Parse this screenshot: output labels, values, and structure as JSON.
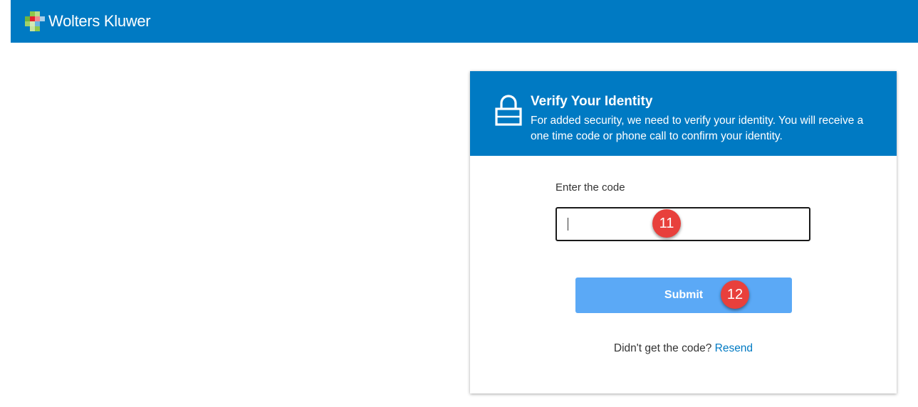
{
  "header": {
    "brand": "Wolters Kluwer"
  },
  "verify": {
    "title": "Verify Your Identity",
    "description": "For added security, we need to verify your identity. You will receive a one time code or phone call to confirm your identity.",
    "code_label": "Enter the code",
    "code_value": "",
    "submit_label": "Submit",
    "resend_prompt": "Didn't get the code?",
    "resend_link": "Resend"
  },
  "annotations": {
    "input_step": "11",
    "submit_step": "12"
  },
  "colors": {
    "brand_blue": "#007ac3",
    "button_blue": "#5ba9f6",
    "badge_red": "#e8403c"
  },
  "icons": {
    "logo": "wolters-kluwer-logo-icon",
    "lock": "lock-icon"
  }
}
